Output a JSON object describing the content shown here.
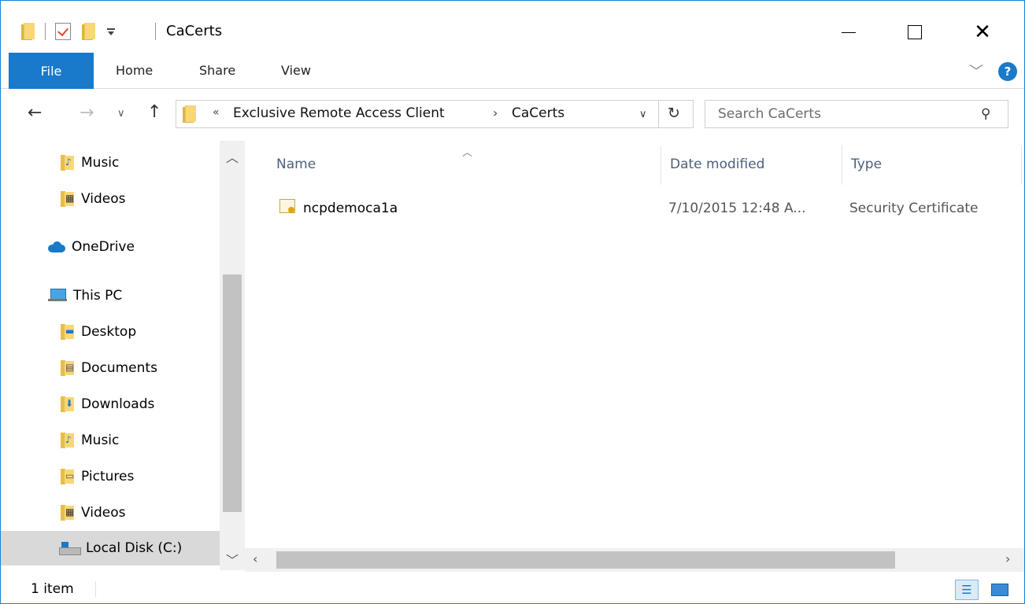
{
  "window": {
    "title": "CaCerts",
    "close_glyph": "✕"
  },
  "ribbon": {
    "tabs": [
      "File",
      "Home",
      "Share",
      "View"
    ],
    "help_label": "?"
  },
  "address": {
    "overflow": "«",
    "crumbs": [
      "Exclusive Remote Access Client",
      "CaCerts"
    ],
    "separator": "›",
    "search_placeholder": "Search CaCerts"
  },
  "nav": {
    "items": [
      {
        "label": "Music",
        "icon": "music-folder-icon"
      },
      {
        "label": "Videos",
        "icon": "videos-folder-icon"
      },
      {
        "label": "OneDrive",
        "icon": "onedrive-cloud-icon"
      },
      {
        "label": "This PC",
        "icon": "this-pc-icon"
      },
      {
        "label": "Desktop",
        "icon": "desktop-folder-icon"
      },
      {
        "label": "Documents",
        "icon": "documents-folder-icon"
      },
      {
        "label": "Downloads",
        "icon": "downloads-folder-icon"
      },
      {
        "label": "Music",
        "icon": "music-folder-icon"
      },
      {
        "label": "Pictures",
        "icon": "pictures-folder-icon"
      },
      {
        "label": "Videos",
        "icon": "videos-folder-icon"
      },
      {
        "label": "Local Disk (C:)",
        "icon": "local-disk-icon"
      }
    ]
  },
  "content": {
    "columns": [
      "Name",
      "Date modified",
      "Type"
    ],
    "files": [
      {
        "name": "ncpdemoca1a",
        "date": "7/10/2015 12:48 A...",
        "type": "Security Certificate",
        "icon": "certificate-icon"
      }
    ]
  },
  "status": {
    "count": "1 item"
  }
}
